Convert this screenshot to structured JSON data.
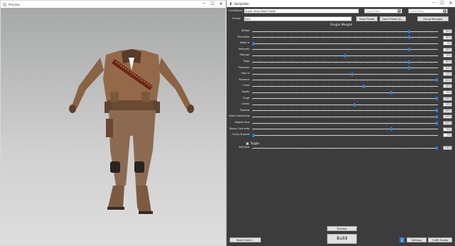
{
  "preview_window": {
    "title": "Preview"
  },
  "bodyslide": {
    "title": "BodySlide",
    "outfit_body_label": "Outfit/Body",
    "outfit_value": "Super Hero Pallet Outfit",
    "group_filter_placeholder": "Group Filter",
    "outfit_filter_placeholder": "Outfit Filter",
    "preset_label": "Preset",
    "preset_value": "Kurt",
    "save_preset": "Save Preset",
    "save_preset_as": "Save Preset As...",
    "group_manager": "Group Manager",
    "section_title": "Single Weight",
    "sliders": [
      {
        "label": "Biceps",
        "value": "85%",
        "pct": 0.85
      },
      {
        "label": "Shoulders",
        "value": "85%",
        "pct": 0.85
      },
      {
        "label": "Waist In",
        "value": "0%",
        "pct": 0.0
      },
      {
        "label": "Pectorals",
        "value": "85%",
        "pct": 0.85
      },
      {
        "label": "Ribcage",
        "value": "50%",
        "pct": 0.5
      },
      {
        "label": "Traps",
        "value": "85%",
        "pct": 0.85
      },
      {
        "label": "Forearms",
        "value": "85%",
        "pct": 0.85
      },
      {
        "label": "Hips In",
        "value": "54%",
        "pct": 0.54
      },
      {
        "label": "Stomach",
        "value": "100%",
        "pct": 1.0
      },
      {
        "label": "Chest",
        "value": "60%",
        "pct": 0.6
      },
      {
        "label": "Booby",
        "value": "75%",
        "pct": 0.75
      },
      {
        "label": "Thigh",
        "value": "100%",
        "pct": 1.0
      },
      {
        "label": "Calves",
        "value": "55%",
        "pct": 0.55
      },
      {
        "label": "Gapsize",
        "value": "100%",
        "pct": 1.0
      },
      {
        "label": "Seam Smoothing",
        "value": "100%",
        "pct": 1.0
      },
      {
        "label": "Nipples Size",
        "value": "100%",
        "pct": 1.0
      },
      {
        "label": "Booby Cola wide",
        "value": "75%",
        "pct": 0.75
      },
      {
        "label": "Flying Grapnel",
        "value": "0%",
        "pct": 0.0
      }
    ],
    "toggle_label": "Toggle",
    "belt_slider": {
      "label": "Belt Size",
      "value": "100%",
      "pct": 1.0
    },
    "preview_button": "Preview",
    "build_button": "Build",
    "batch_build_button": "Batch Build...",
    "settings_button": "Settings",
    "outfit_studio_button": "Outfit Studio",
    "colors": {
      "panel_bg": "#3c3c3c",
      "slider_thumb": "#2f7fdc",
      "viewport_top": "#a7a8a8",
      "viewport_bottom": "#dedede"
    }
  }
}
